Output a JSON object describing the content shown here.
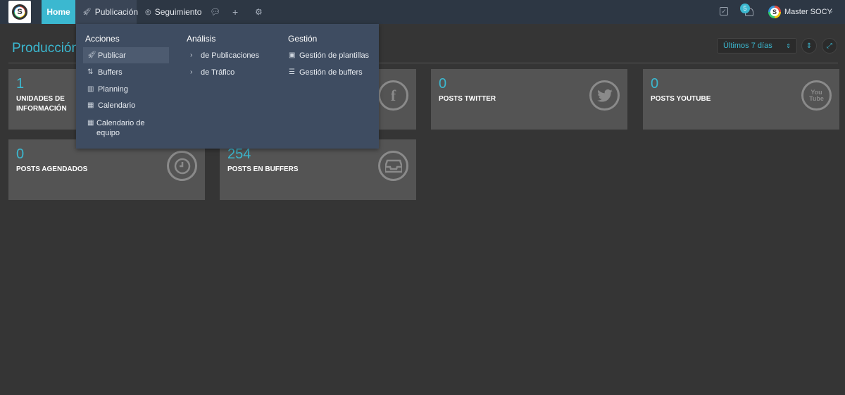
{
  "nav": {
    "home": "Home",
    "publicacion": "Publicación",
    "seguimiento": "Seguimiento",
    "user_name": "Master SOCY",
    "notifications_count": "5"
  },
  "page": {
    "title": "Producción",
    "range_select": "Últimos 7 días"
  },
  "cards": [
    {
      "value": "1",
      "label": "UNIDADES DE INFORMACIÓN",
      "icon": "facebook-icon"
    },
    {
      "value": "0",
      "label": "POSTS TWITTER",
      "icon": "twitter-icon"
    },
    {
      "value": "0",
      "label": "POSTS YOUTUBE",
      "icon": "youtube-icon"
    },
    {
      "value": "0",
      "label": "POSTS AGENDADOS",
      "icon": "clock-icon"
    },
    {
      "value": "254",
      "label": "POSTS EN BUFFERS",
      "icon": "inbox-icon"
    }
  ],
  "dropdown": {
    "acciones": {
      "title": "Acciones",
      "items": [
        "Publicar",
        "Buffers",
        "Planning",
        "Calendario",
        "Calendario de equipo"
      ]
    },
    "analisis": {
      "title": "Análisis",
      "items": [
        "de Publicaciones",
        "de Tráfico"
      ]
    },
    "gestion": {
      "title": "Gestión",
      "items": [
        "Gestión de plantillas",
        "Gestión de buffers"
      ]
    }
  },
  "colors": {
    "accent": "#3bb8d0",
    "topbar": "#2d3744",
    "dropdown": "#3e4c61",
    "card": "#545454",
    "background": "#353535"
  }
}
